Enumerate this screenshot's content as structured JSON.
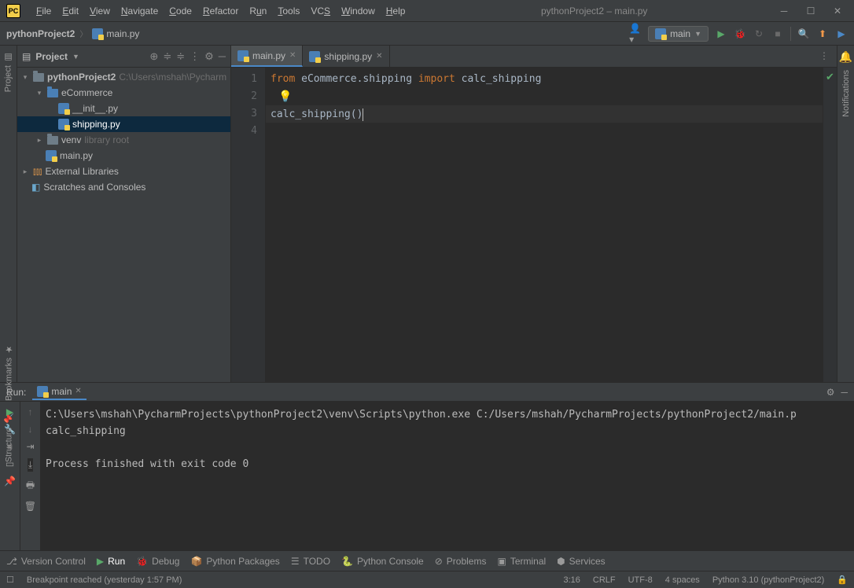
{
  "title": "pythonProject2 – main.py",
  "menu": [
    "File",
    "Edit",
    "View",
    "Navigate",
    "Code",
    "Refactor",
    "Run",
    "Tools",
    "VCS",
    "Window",
    "Help"
  ],
  "breadcrumb": {
    "project": "pythonProject2",
    "file": "main.py"
  },
  "run_config": "main",
  "project_panel": {
    "title": "Project",
    "tree": {
      "root": "pythonProject2",
      "root_path": "C:\\Users\\mshah\\Pycharm",
      "ecommerce": "eCommerce",
      "init": "__init__.py",
      "shipping": "shipping.py",
      "venv": "venv",
      "venv_hint": "library root",
      "mainpy": "main.py",
      "ext": "External Libraries",
      "scratch": "Scratches and Consoles"
    }
  },
  "tabs": [
    {
      "label": "main.py",
      "active": true
    },
    {
      "label": "shipping.py",
      "active": false
    }
  ],
  "code": {
    "lines": [
      "1",
      "2",
      "3",
      "4"
    ],
    "l1_kw1": "from",
    "l1_mod": "eCommerce.shipping",
    "l1_kw2": "import",
    "l1_fn": "calc_shipping",
    "l3_fn": "calc_shipping",
    "l3_par": "()"
  },
  "run": {
    "label": "Run:",
    "tab": "main",
    "console_l1": "C:\\Users\\mshah\\PycharmProjects\\pythonProject2\\venv\\Scripts\\python.exe C:/Users/mshah/PycharmProjects/pythonProject2/main.p",
    "console_l2": "calc_shipping",
    "console_l3": "",
    "console_l4": "Process finished with exit code 0"
  },
  "bottom_tabs": {
    "vc": "Version Control",
    "run": "Run",
    "debug": "Debug",
    "pp": "Python Packages",
    "todo": "TODO",
    "pc": "Python Console",
    "prob": "Problems",
    "term": "Terminal",
    "serv": "Services"
  },
  "status": {
    "msg": "Breakpoint reached (yesterday 1:57 PM)",
    "pos": "3:16",
    "crlf": "CRLF",
    "enc": "UTF-8",
    "indent": "4 spaces",
    "interp": "Python 3.10 (pythonProject2)"
  },
  "side": {
    "project": "Project",
    "bookmarks": "Bookmarks",
    "structure": "Structure",
    "notifications": "Notifications"
  }
}
